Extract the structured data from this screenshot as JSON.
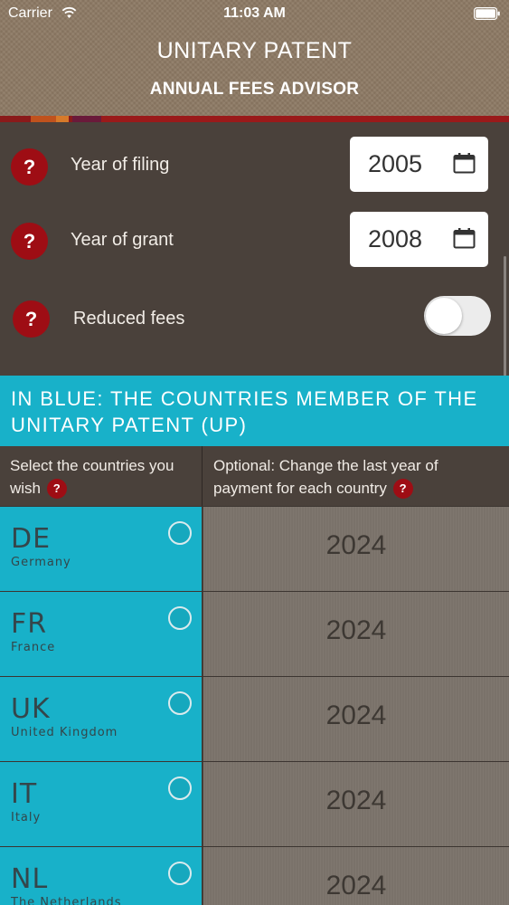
{
  "status_bar": {
    "carrier": "Carrier",
    "time": "11:03 AM"
  },
  "header": {
    "title": "UNITARY PATENT",
    "subtitle": "ANNUAL FEES ADVISOR"
  },
  "settings": {
    "help_glyph": "?",
    "filing": {
      "label": "Year of filing",
      "value": "2005"
    },
    "grant": {
      "label": "Year of grant",
      "value": "2008"
    },
    "reduced": {
      "label": "Reduced fees",
      "enabled": false
    }
  },
  "banner": {
    "text": "IN BLUE: THE COUNTRIES MEMBER OF THE UNITARY PATENT (UP)"
  },
  "columns": {
    "left": "Select the countries you wish",
    "right": "Optional: Change the last year of payment for each country"
  },
  "countries": [
    {
      "code": "DE",
      "name": "Germany",
      "last_year": "2024",
      "selected": false
    },
    {
      "code": "FR",
      "name": "France",
      "last_year": "2024",
      "selected": false
    },
    {
      "code": "UK",
      "name": "United Kingdom",
      "last_year": "2024",
      "selected": false
    },
    {
      "code": "IT",
      "name": "Italy",
      "last_year": "2024",
      "selected": false
    },
    {
      "code": "NL",
      "name": "The Netherlands",
      "last_year": "2024",
      "selected": false
    }
  ],
  "colors": {
    "header_bg": "#8d7a64",
    "panel_bg": "#4a413b",
    "accent_blue": "#18b1c9",
    "help_red": "#9e0d14",
    "year_cell_bg": "#7c746c"
  },
  "icons": {
    "wifi": "wifi-icon",
    "battery": "battery-icon",
    "help": "help-icon",
    "calendar": "calendar-icon",
    "radio": "radio-button-icon"
  }
}
